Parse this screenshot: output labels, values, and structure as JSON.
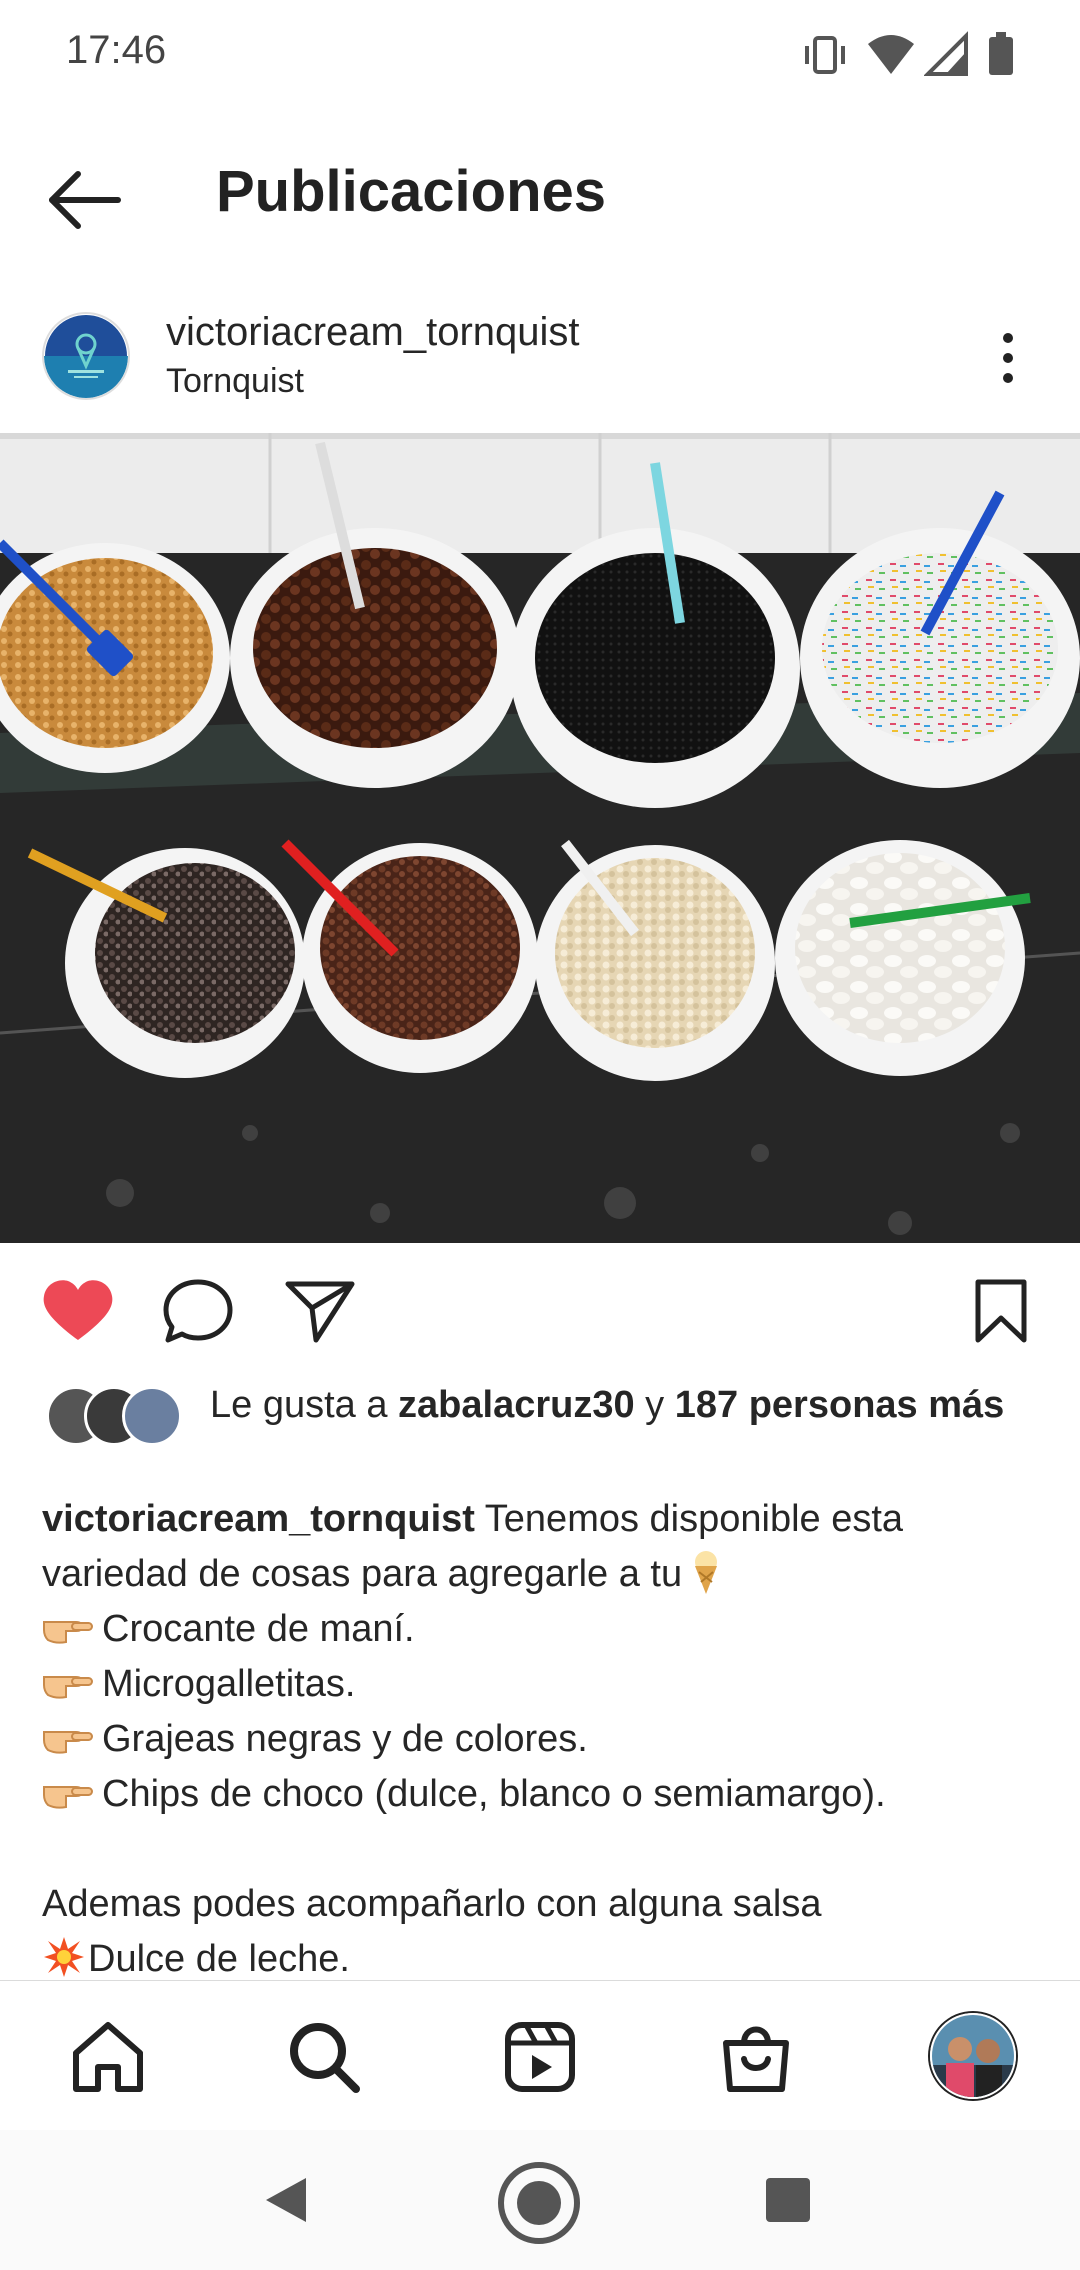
{
  "status_bar": {
    "time": "17:46"
  },
  "header": {
    "title": "Publicaciones"
  },
  "post": {
    "username": "victoriacream_tornquist",
    "location": "Tornquist",
    "liked": true,
    "likes": {
      "prefix": "Le gusta a ",
      "user": "zabalacruz30",
      "connector": " y ",
      "others": "187 personas más"
    },
    "caption": {
      "username": "victoriacream_tornquist",
      "line1": " Tenemos disponible esta",
      "line2": "variedad de cosas para agregarle a tu",
      "items": [
        "Crocante de maní.",
        "Microgalletitas.",
        "Grajeas negras y de colores.",
        "Chips de choco (dulce, blanco o semiamargo)."
      ],
      "extra": "Ademas podes acompañarlo con alguna salsa",
      "sauce": "Dulce de leche."
    }
  },
  "icons": {
    "back": "arrow-left-icon",
    "more": "vertical-dots-icon",
    "like": "heart-filled-icon",
    "comment": "speech-bubble-icon",
    "share": "paper-plane-icon",
    "save": "bookmark-icon",
    "nav": [
      "home-icon",
      "search-icon",
      "reels-icon",
      "shop-icon",
      "profile-avatar"
    ]
  },
  "colors": {
    "like_red": "#ed4956",
    "text": "#262626"
  }
}
